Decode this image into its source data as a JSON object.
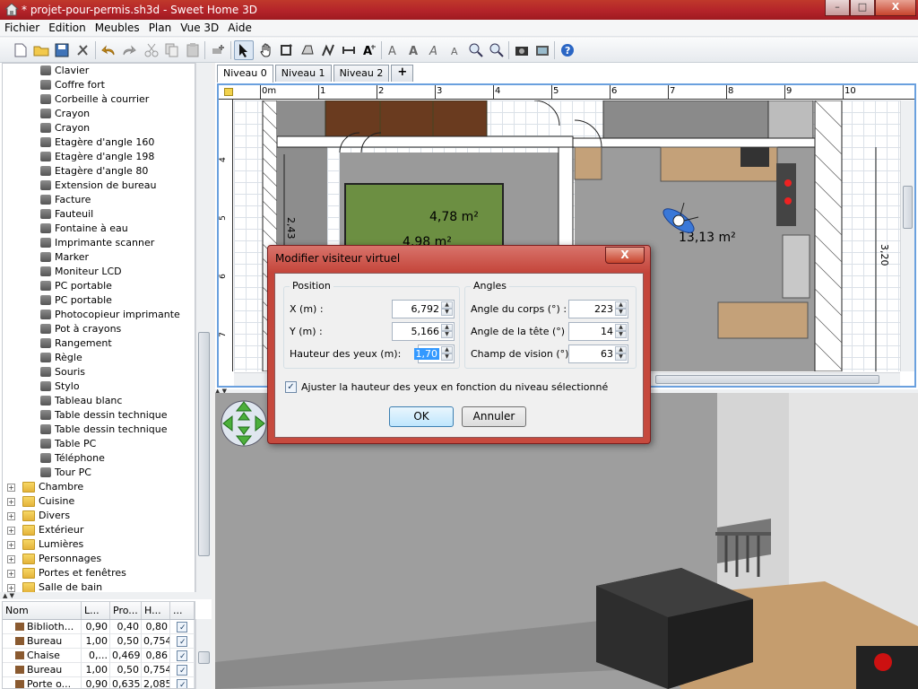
{
  "window": {
    "title": "* projet-pour-permis.sh3d - Sweet Home 3D",
    "minimize": "–",
    "maximize": "□",
    "close": "X"
  },
  "menu": [
    "Fichier",
    "Edition",
    "Meubles",
    "Plan",
    "Vue 3D",
    "Aide"
  ],
  "catalog": {
    "items": [
      {
        "label": "Clavier",
        "icon": "keyboard-icon"
      },
      {
        "label": "Coffre fort",
        "icon": "safe-icon"
      },
      {
        "label": "Corbeille à courrier",
        "icon": "mail-tray-icon"
      },
      {
        "label": "Crayon",
        "icon": "pencil-icon"
      },
      {
        "label": "Crayon",
        "icon": "pencil-icon"
      },
      {
        "label": "Etagère d'angle 160",
        "icon": "corner-shelf-icon"
      },
      {
        "label": "Etagère d'angle 198",
        "icon": "corner-shelf-icon"
      },
      {
        "label": "Etagère d'angle 80",
        "icon": "corner-shelf-icon"
      },
      {
        "label": "Extension de bureau",
        "icon": "desk-extension-icon"
      },
      {
        "label": "Facture",
        "icon": "invoice-icon"
      },
      {
        "label": "Fauteuil",
        "icon": "armchair-icon"
      },
      {
        "label": "Fontaine à eau",
        "icon": "water-fountain-icon"
      },
      {
        "label": "Imprimante scanner",
        "icon": "printer-icon"
      },
      {
        "label": "Marker",
        "icon": "marker-icon"
      },
      {
        "label": "Moniteur LCD",
        "icon": "monitor-icon"
      },
      {
        "label": "PC portable",
        "icon": "laptop-icon"
      },
      {
        "label": "PC portable",
        "icon": "laptop-icon"
      },
      {
        "label": "Photocopieur imprimante",
        "icon": "photocopier-icon"
      },
      {
        "label": "Pot à crayons",
        "icon": "pencil-pot-icon"
      },
      {
        "label": "Rangement",
        "icon": "storage-icon"
      },
      {
        "label": "Règle",
        "icon": "ruler-icon"
      },
      {
        "label": "Souris",
        "icon": "mouse-icon"
      },
      {
        "label": "Stylo",
        "icon": "pen-icon"
      },
      {
        "label": "Tableau blanc",
        "icon": "whiteboard-icon"
      },
      {
        "label": "Table dessin technique",
        "icon": "drafting-table-icon"
      },
      {
        "label": "Table dessin technique",
        "icon": "drafting-table-icon"
      },
      {
        "label": "Table PC",
        "icon": "computer-table-icon"
      },
      {
        "label": "Téléphone",
        "icon": "telephone-icon"
      },
      {
        "label": "Tour PC",
        "icon": "pc-tower-icon"
      }
    ],
    "categories": [
      "Chambre",
      "Cuisine",
      "Divers",
      "Extérieur",
      "Lumières",
      "Personnages",
      "Portes et fenêtres",
      "Salle de bain"
    ]
  },
  "furniture_table": {
    "headers": [
      "Nom",
      "L...",
      "Pro...",
      "H...",
      "..."
    ],
    "rows": [
      {
        "name": "Biblioth...",
        "w": "0,90",
        "d": "0,40",
        "h": "0,80",
        "visible": "✓"
      },
      {
        "name": "Bureau",
        "w": "1,00",
        "d": "0,50",
        "h": "0,754",
        "visible": "✓"
      },
      {
        "name": "Chaise",
        "w": "0,...",
        "d": "0,469",
        "h": "0,86",
        "visible": "✓"
      },
      {
        "name": "Bureau",
        "w": "1,00",
        "d": "0,50",
        "h": "0,754",
        "visible": "✓"
      },
      {
        "name": "Porte o...",
        "w": "0,90",
        "d": "0,635",
        "h": "2,085",
        "visible": "✓"
      }
    ]
  },
  "plan": {
    "tabs": [
      "Niveau 0",
      "Niveau 1",
      "Niveau 2",
      "+"
    ],
    "ruler_top": [
      "0m",
      "1",
      "2",
      "3",
      "4",
      "5",
      "6",
      "7",
      "8",
      "9",
      "10"
    ],
    "ruler_left": [
      "4",
      "5",
      "6",
      "7"
    ],
    "rooms": [
      {
        "area": "4,78 m²"
      },
      {
        "area": "4,98 m²"
      },
      {
        "area": "13,13 m²"
      }
    ],
    "dims": {
      "left": "2,43",
      "right": "3,20"
    }
  },
  "dialog": {
    "title": "Modifier visiteur virtuel",
    "close": "X",
    "position_group": "Position",
    "angles_group": "Angles",
    "x_label": "X (m) :",
    "x_value": "6,792",
    "y_label": "Y (m) :",
    "y_value": "5,166",
    "eye_label": "Hauteur des yeux (m):",
    "eye_value": "1,70",
    "body_label": "Angle du corps (°) :",
    "body_value": "223",
    "head_label": "Angle de la tête (°) :",
    "head_value": "14",
    "fov_label": "Champ de vision (°) :",
    "fov_value": "63",
    "adjust_label": "Ajuster la hauteur des yeux en fonction du niveau sélectionné",
    "adjust_checked": "✓",
    "ok": "OK",
    "cancel": "Annuler"
  }
}
